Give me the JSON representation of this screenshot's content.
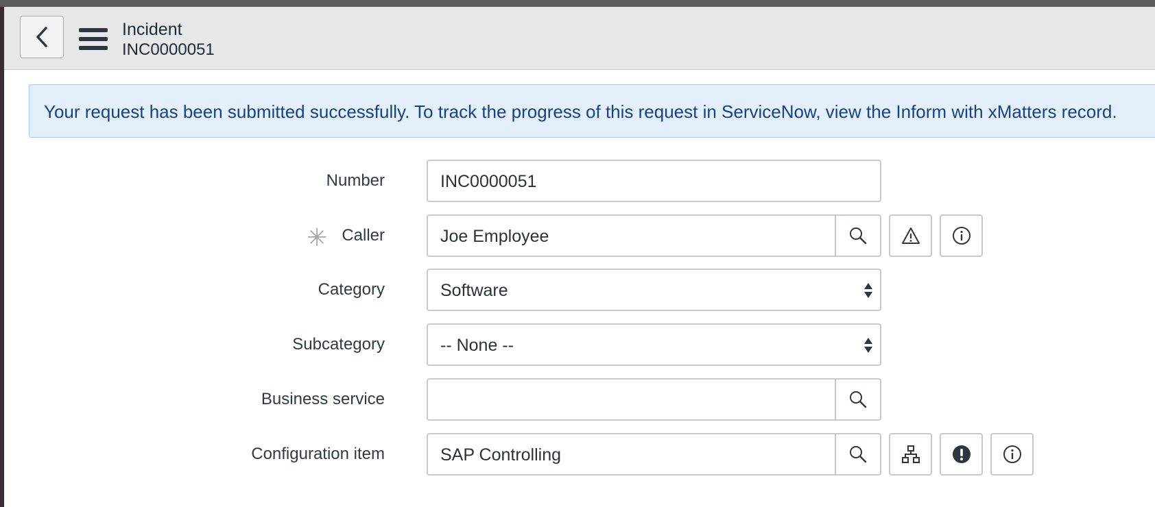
{
  "header": {
    "title": "Incident",
    "subtitle": "INC0000051"
  },
  "banner": {
    "text_before": "Your request has been submitted successfully. To track the progress of this request in ServiceNow, view the ",
    "link_text": "Inform with xMatters record",
    "text_after": "."
  },
  "form": {
    "number": {
      "label": "Number",
      "value": "INC0000051"
    },
    "caller": {
      "label": "Caller",
      "value": "Joe Employee",
      "required_mark": "✳"
    },
    "category": {
      "label": "Category",
      "value": "Software"
    },
    "subcategory": {
      "label": "Subcategory",
      "value": "-- None --"
    },
    "business_service": {
      "label": "Business service",
      "value": ""
    },
    "configuration_item": {
      "label": "Configuration item",
      "value": "SAP Controlling"
    }
  },
  "icons": {
    "back": "chevron-left-icon",
    "menu": "hamburger-menu-icon",
    "lookup": "search-icon",
    "warning": "warning-triangle-icon",
    "info": "info-circle-icon",
    "dependency": "dependency-tree-icon",
    "alert": "exclamation-circle-icon"
  },
  "colors": {
    "banner_bg": "#e3effa",
    "banner_text": "#15428b",
    "header_bg": "#e6e7e8"
  }
}
